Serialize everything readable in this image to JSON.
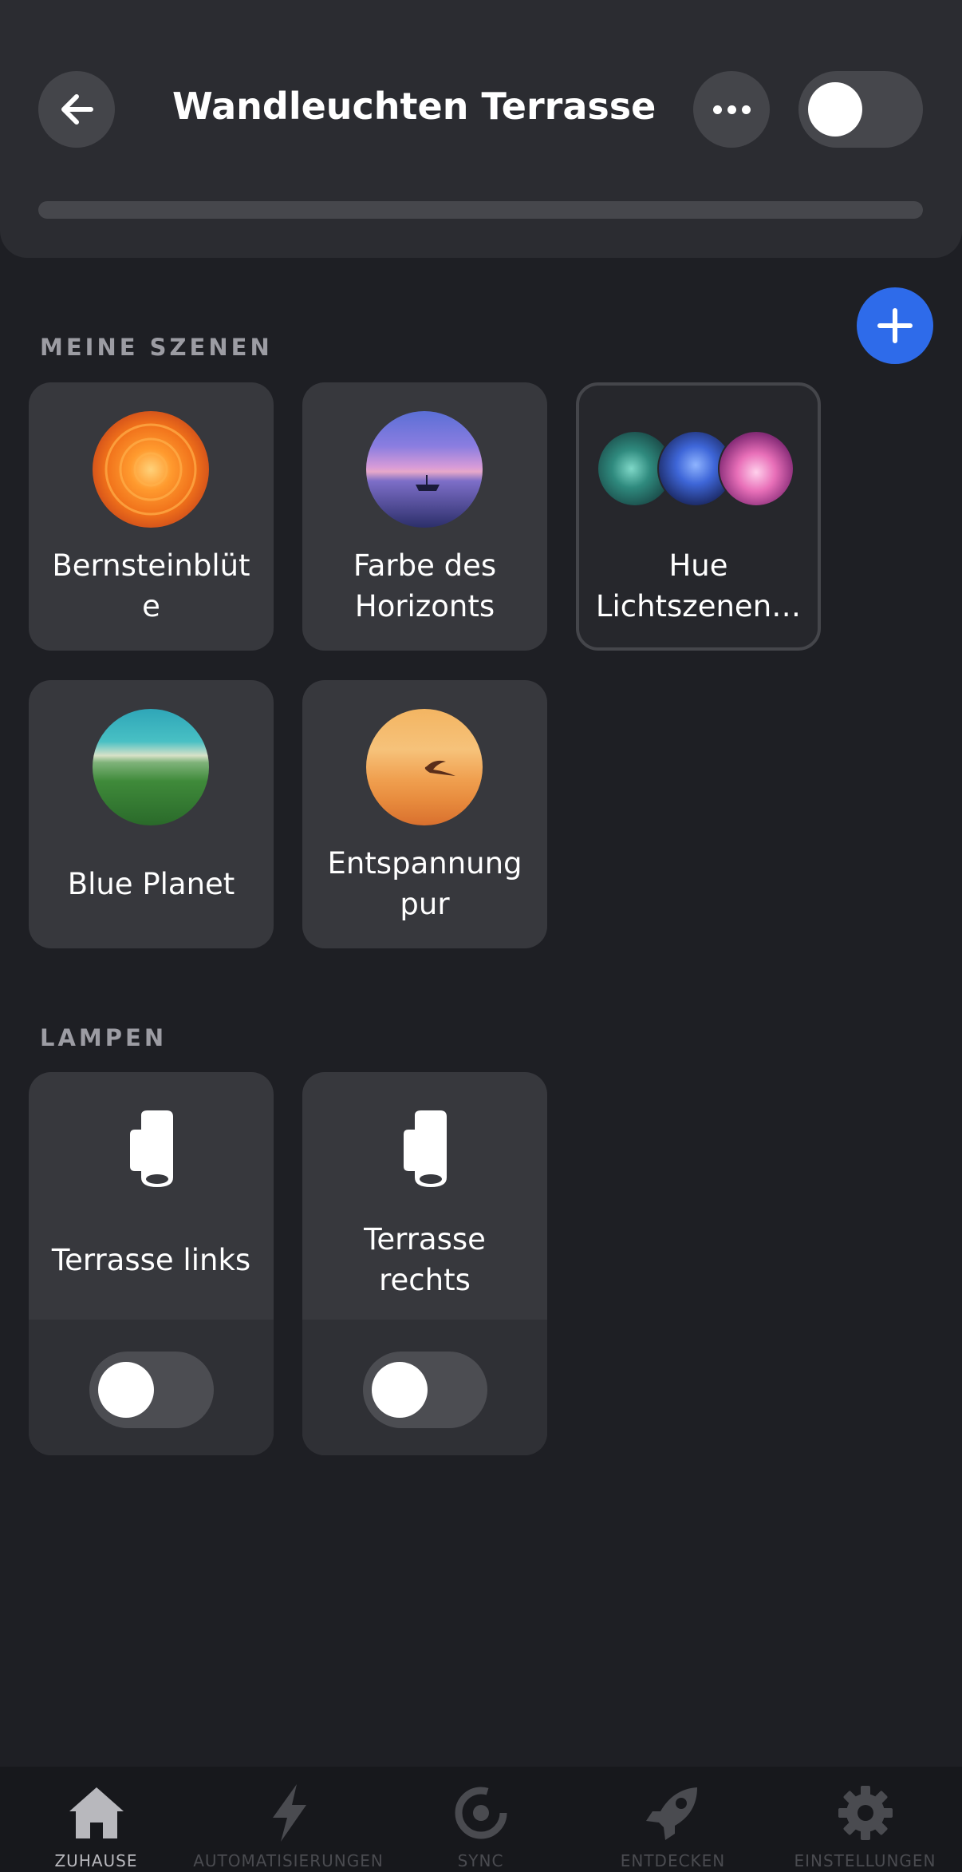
{
  "header": {
    "title": "Wandleuchten Terrasse",
    "back_icon": "arrow-left-icon",
    "more_icon": "more-horizontal-icon",
    "toggle_on": false,
    "brightness": 0
  },
  "scenes_section": {
    "label": "MEINE SZENEN",
    "add_icon": "plus-icon",
    "accent_color": "#2e6bea"
  },
  "scenes": [
    {
      "label": "Bernsteinblüt\ne",
      "image": "orange-dahlia-photo"
    },
    {
      "label": "Farbe des\nHorizonts",
      "image": "purple-lake-boat-photo"
    },
    {
      "label": "Hue\nLichtszenen…",
      "image": "scene-gallery-photos"
    },
    {
      "label": "Blue Planet",
      "image": "aerial-beach-forest-photo"
    },
    {
      "label": "Entspannung\npur",
      "image": "sunset-bird-photo"
    }
  ],
  "lamps_section": {
    "label": "LAMPEN"
  },
  "lamps": [
    {
      "label": "Terrasse links",
      "icon": "wall-light-icon",
      "on": false
    },
    {
      "label": "Terrasse\nrechts",
      "icon": "wall-light-icon",
      "on": false
    }
  ],
  "nav": [
    {
      "label": "ZUHAUSE",
      "icon": "home-icon",
      "active": true
    },
    {
      "label": "AUTOMATISIERUNGEN",
      "icon": "lightning-icon",
      "active": false
    },
    {
      "label": "SYNC",
      "icon": "sync-icon",
      "active": false
    },
    {
      "label": "ENTDECKEN",
      "icon": "rocket-icon",
      "active": false
    },
    {
      "label": "EINSTELLUNGEN",
      "icon": "gear-icon",
      "active": false
    }
  ]
}
